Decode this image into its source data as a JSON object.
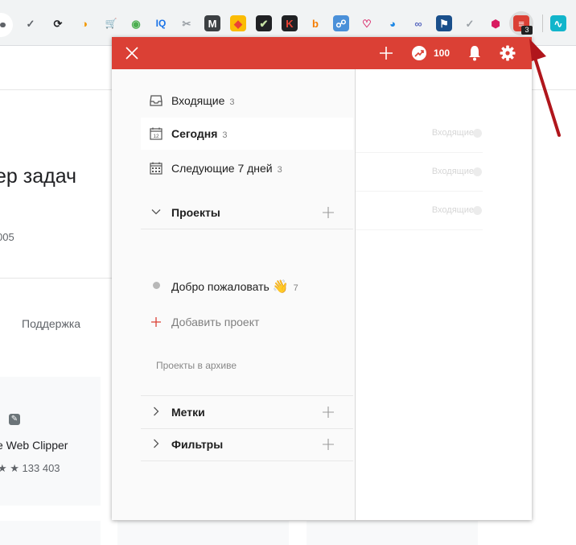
{
  "toolbar": {
    "extensions": [
      {
        "icon": "check-icon",
        "color": "#5f6368",
        "glyph": "✓",
        "fg": "#5f6368",
        "bg": "transparent"
      },
      {
        "icon": "sync-icon",
        "color": "#202124",
        "glyph": "⟳",
        "fg": "#202124",
        "bg": "transparent"
      },
      {
        "icon": "half-circle-icon",
        "color": "#f29900",
        "glyph": "◑",
        "fg": "#f29900",
        "bg": "transparent"
      },
      {
        "icon": "cart-icon",
        "color": "#e53935",
        "glyph": "🛒",
        "fg": "#e53935",
        "bg": "transparent"
      },
      {
        "icon": "color-wheel-icon",
        "color": "#444444",
        "glyph": "◉",
        "fg": "#4caf50",
        "bg": "transparent"
      },
      {
        "icon": "iq-icon",
        "color": "#1a73e8",
        "glyph": "IQ",
        "fg": "#1a73e8",
        "bg": "transparent"
      },
      {
        "icon": "scissors-icon",
        "color": "#9aa0a6",
        "glyph": "✂",
        "fg": "#9aa0a6",
        "bg": "transparent"
      },
      {
        "icon": "m-icon",
        "color": "#3c4043",
        "glyph": "M",
        "fg": "#ffffff",
        "bg": "#3c4043"
      },
      {
        "icon": "flag-icon",
        "color": "#fbbc04",
        "glyph": "◆",
        "fg": "#ea4335",
        "bg": "#fbbc04"
      },
      {
        "icon": "checklist-icon",
        "color": "#202124",
        "glyph": "✔",
        "fg": "#c5e1a5",
        "bg": "#202124"
      },
      {
        "icon": "k-icon",
        "color": "#202124",
        "glyph": "K",
        "fg": "#ea4335",
        "bg": "#202124"
      },
      {
        "icon": "b-circle-icon",
        "color": "#f57c00",
        "glyph": "b",
        "fg": "#f57c00",
        "bg": "transparent"
      },
      {
        "icon": "feed-icon",
        "color": "#4a90d9",
        "glyph": "☍",
        "fg": "#ffffff",
        "bg": "#4a90d9"
      },
      {
        "icon": "heart-icon",
        "color": "#d81b60",
        "glyph": "♡",
        "fg": "#d81b60",
        "bg": "transparent"
      },
      {
        "icon": "pie-icon",
        "color": "#1e88e5",
        "glyph": "◕",
        "fg": "#1e88e5",
        "bg": "transparent"
      },
      {
        "icon": "link-icon",
        "color": "#5c6bc0",
        "glyph": "∞",
        "fg": "#5c6bc0",
        "bg": "transparent"
      },
      {
        "icon": "bookmark-icon",
        "color": "#1a4f8b",
        "glyph": "⚑",
        "fg": "#ffffff",
        "bg": "#1a4f8b"
      },
      {
        "icon": "tick-icon",
        "color": "#9aa0a6",
        "glyph": "✓",
        "fg": "#9aa0a6",
        "bg": "transparent"
      },
      {
        "icon": "hexagon-icon",
        "color": "#d81b60",
        "glyph": "⬢",
        "fg": "#d81b60",
        "bg": "transparent"
      },
      {
        "icon": "todoist-icon",
        "color": "#db4035",
        "glyph": "≡",
        "fg": "#ffffff",
        "bg": "#db4035"
      },
      {
        "icon": "pulse-icon",
        "color": "#12b5cb",
        "glyph": "∿",
        "fg": "#ffffff",
        "bg": "#12b5cb"
      }
    ],
    "todoist_badge": "3"
  },
  "background_page": {
    "heading": "ер задач",
    "subtext": "005",
    "support_link": "Поддержка",
    "card_title": "e Web Clipper",
    "card_rating": "★ ★  133 403"
  },
  "popup": {
    "header": {
      "karma": "100",
      "accent_color": "#db4035"
    },
    "nav": [
      {
        "label": "Входящие",
        "count": "3",
        "icon": "inbox-icon"
      },
      {
        "label": "Сегодня",
        "count": "3",
        "icon": "calendar-today-icon"
      },
      {
        "label": "Следующие 7 дней",
        "count": "3",
        "icon": "calendar-week-icon"
      }
    ],
    "today_day": "12",
    "projects_section": {
      "label": "Проекты"
    },
    "project_item": {
      "label": "Добро пожаловать",
      "emoji": "👋",
      "count": "7"
    },
    "add_project_label": "Добавить проект",
    "archive_label": "Проекты в архиве",
    "labels_section": {
      "label": "Метки"
    },
    "filters_section": {
      "label": "Фильтры"
    },
    "tasks": [
      {
        "project": "Входящие"
      },
      {
        "project": "Входящие"
      },
      {
        "project": "Входящие"
      }
    ]
  }
}
